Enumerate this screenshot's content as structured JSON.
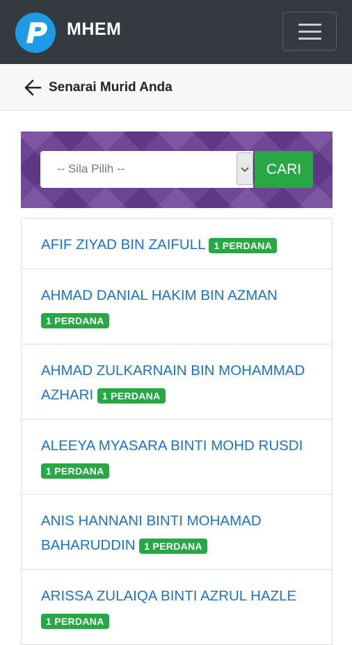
{
  "app": {
    "brand": "MHEM"
  },
  "header": {
    "title": "Senarai Murid Anda"
  },
  "search": {
    "select_value": "-- Sila Pilih --",
    "button_label": "CARI"
  },
  "students": [
    {
      "name": "AFIF ZIYAD BIN ZAIFULL",
      "class": "1 PERDANA"
    },
    {
      "name": "AHMAD DANIAL HAKIM BIN AZMAN",
      "class": "1 PERDANA"
    },
    {
      "name": "AHMAD ZULKARNAIN BIN MOHAMMAD AZHARI",
      "class": "1 PERDANA"
    },
    {
      "name": "ALEEYA MYASARA BINTI MOHD RUSDI",
      "class": "1 PERDANA"
    },
    {
      "name": "ANIS HANNANI BINTI MOHAMAD BAHARUDDIN",
      "class": "1 PERDANA"
    },
    {
      "name": "ARISSA ZULAIQA BINTI AZRUL HAZLE",
      "class": "1 PERDANA"
    }
  ],
  "colors": {
    "navbar": "#343a40",
    "accent": "#28a745",
    "link": "#1a73c9",
    "panel": "#6a3d93"
  }
}
